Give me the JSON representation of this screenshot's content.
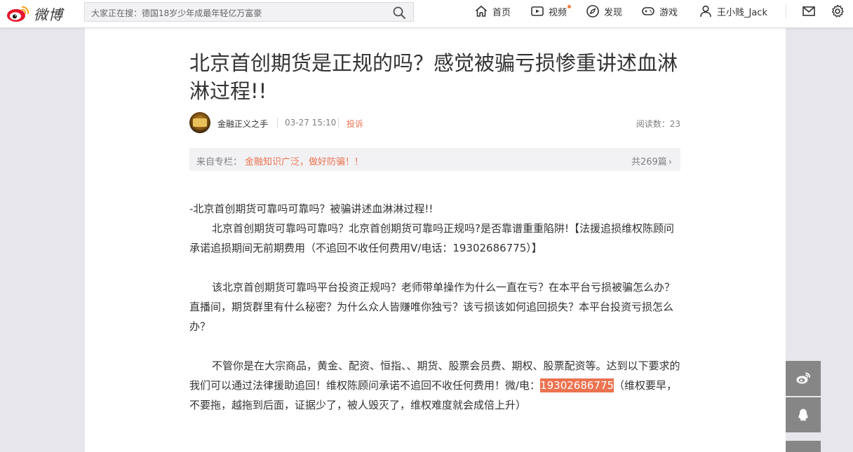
{
  "topbar": {
    "logo_text": "微博",
    "search_text": "大家正在搜：德国18岁少年成最年轻亿万富豪",
    "nav": {
      "home": "首页",
      "video": "视频",
      "discover": "发现",
      "game": "游戏",
      "user": "王小贱_Jack"
    }
  },
  "article": {
    "title": "北京首创期货是正规的吗？感觉被骗亏损惨重讲述血淋淋过程!!",
    "author": "金融正义之手",
    "date": "03-27 15:10",
    "report": "投诉",
    "reads": "阅读数：23",
    "column": {
      "label": "来自专栏：",
      "name": "金融知识广泛，做好防骗！！",
      "count": "共269篇"
    },
    "paragraphs": {
      "p1": "-北京首创期货可靠吗可靠吗？被骗讲述血淋淋过程!!",
      "p2": "北京首创期货可靠吗可靠吗？北京首创期货可靠吗正规吗?是否靠谱重重陷阱!【法援追损维权陈顾问承诺追损期间无前期费用（不追回不收任何费用V/电话：19302686775）】",
      "p3": "该北京首创期货可靠吗平台投资正规吗？老师带单操作为什么一直在亏？在本平台亏损被骗怎么办？直播间，期货群里有什么秘密？为什么众人皆赚唯你独亏？该亏损该如何追回损失？本平台投资亏损怎么办？",
      "p4_start": "不管你是在大宗商品，黄金、配资、恒指、、期货、股票会员费、期权、股票配资等。达到以下要求的我们可以通过法律援助追回！维权陈顾问承诺不追回不收任何费用！微/电：",
      "p4_phone": "19302686775",
      "p4_end": "（维权要早，不要拖，越拖到后面，证据少了，被人毁灭了，维权难度就会成倍上升）"
    }
  },
  "colors": {
    "accent": "#eb7350",
    "nav_dot": "#fa7d3c",
    "float_btn": "#868686"
  },
  "icons": [
    "weibo-logo-icon",
    "search-icon",
    "home-icon",
    "video-icon",
    "discover-icon",
    "game-icon",
    "user-icon",
    "mail-icon",
    "settings-icon",
    "chevron-right-icon",
    "weibo-share-icon",
    "qq-icon"
  ]
}
